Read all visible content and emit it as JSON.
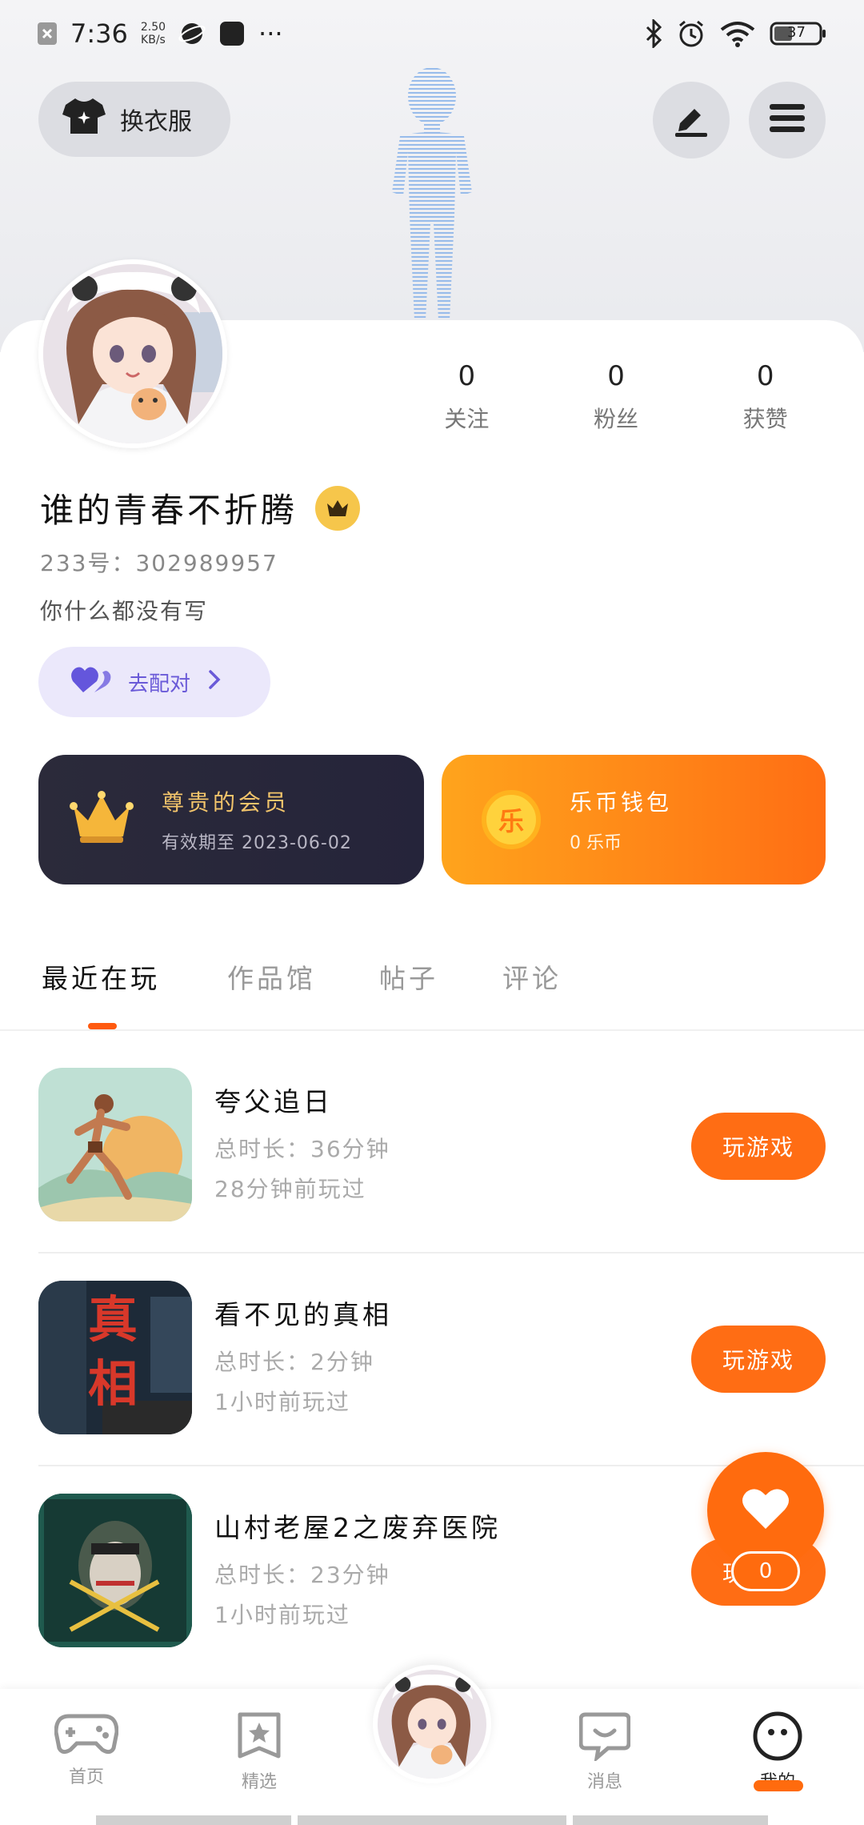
{
  "status_bar": {
    "time": "7:36",
    "net_speed_value": "2.50",
    "net_speed_unit": "KB/s",
    "more": "···",
    "battery": "37"
  },
  "header": {
    "outfit_label": "换衣服",
    "edit_icon": "edit-icon",
    "menu_icon": "menu-icon"
  },
  "profile": {
    "stats": [
      {
        "value": "0",
        "label": "关注"
      },
      {
        "value": "0",
        "label": "粉丝"
      },
      {
        "value": "0",
        "label": "获赞"
      }
    ],
    "username": "谁的青春不折腾",
    "uid": "233号：302989957",
    "bio": "你什么都没有写",
    "match_label": "去配对"
  },
  "vip": {
    "title": "尊贵的会员",
    "expiry": "有效期至 2023-06-02"
  },
  "wallet": {
    "coin_char": "乐",
    "title": "乐币钱包",
    "balance": "0 乐币"
  },
  "tabs": [
    "最近在玩",
    "作品馆",
    "帖子",
    "评论"
  ],
  "games": [
    {
      "name": "夸父追日",
      "total": "总时长：36分钟",
      "last": "28分钟前玩过",
      "action": "玩游戏"
    },
    {
      "name": "看不见的真相",
      "total": "总时长：2分钟",
      "last": "1小时前玩过",
      "action": "玩游戏"
    },
    {
      "name": "山村老屋2之废弃医院",
      "total": "总时长：23分钟",
      "last": "1小时前玩过",
      "action": "玩游戏"
    }
  ],
  "thumb_text": {
    "game2_line1": "真",
    "game2_line2": "相"
  },
  "fab": {
    "count": "0"
  },
  "bottom_nav": [
    {
      "label": "首页",
      "icon": "gamepad-icon"
    },
    {
      "label": "精选",
      "icon": "star-icon"
    },
    {
      "label": "",
      "icon": "avatar"
    },
    {
      "label": "消息",
      "icon": "message-icon"
    },
    {
      "label": "我的",
      "icon": "face-icon"
    }
  ],
  "colors": {
    "accent": "#ff6d14",
    "vip_gold": "#f2c46b",
    "match_purple": "#6a5ad8"
  }
}
